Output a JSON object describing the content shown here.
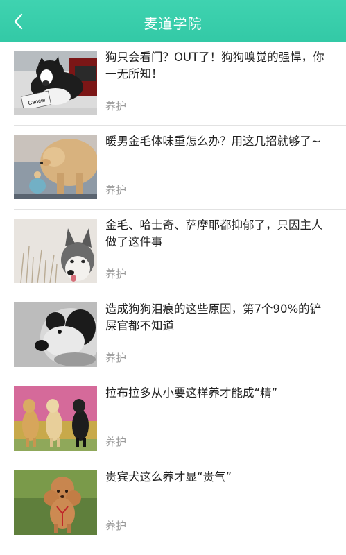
{
  "header": {
    "title": "麦道学院",
    "back_icon": "chevron-left-icon",
    "color": "#38cda9"
  },
  "articles": [
    {
      "title": "狗只会看门？OUT了！狗狗嗅觉的强悍，你一无所知！",
      "tag": "养护",
      "image_label": "Cancer"
    },
    {
      "title": "暖男金毛体味重怎么办？用这几招就够了~",
      "tag": "养护"
    },
    {
      "title": "金毛、哈士奇、萨摩耶都抑郁了，只因主人做了这件事",
      "tag": "养护"
    },
    {
      "title": "造成狗狗泪痕的这些原因，第7个90%的铲屎官都不知道",
      "tag": "养护"
    },
    {
      "title": "拉布拉多从小要这样养才能成“精”",
      "tag": "养护"
    },
    {
      "title": "贵宾犬这么养才显“贵气”",
      "tag": "养护"
    }
  ]
}
